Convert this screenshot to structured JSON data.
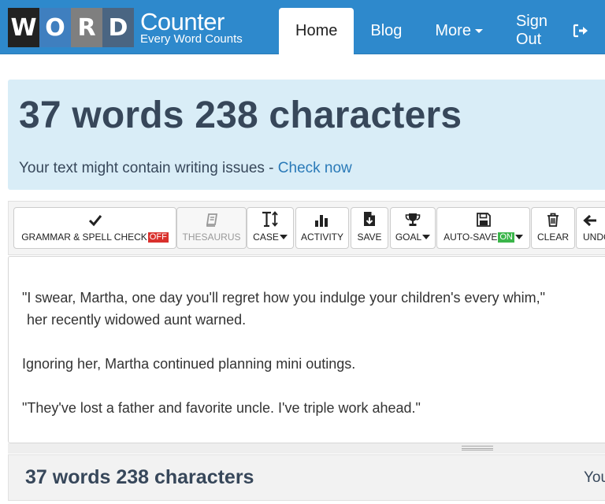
{
  "brand": {
    "letters": [
      "W",
      "O",
      "R",
      "D"
    ],
    "title": "Counter",
    "tagline": "Every Word Counts",
    "colors": {
      "navbar": "#2e89cc",
      "word_boxes": [
        "#222222",
        "#3f7fbf",
        "#7f7f7f",
        "#4a6582"
      ]
    }
  },
  "nav": {
    "home": "Home",
    "blog": "Blog",
    "more": "More",
    "signout": "Sign Out"
  },
  "stats": {
    "headline": "37 words 238 characters",
    "issues_text": "Your text might contain writing issues - ",
    "issues_link": "Check now"
  },
  "toolbar": {
    "grammar": {
      "label": "GRAMMAR & SPELL CHECK",
      "badge": "OFF",
      "icon": "checkmark-icon"
    },
    "thesaurus": {
      "label": "THESAURUS",
      "icon": "book-icon"
    },
    "case": {
      "label": "CASE",
      "icon": "text-case-icon"
    },
    "activity": {
      "label": "ACTIVITY",
      "icon": "bar-chart-icon"
    },
    "save": {
      "label": "SAVE",
      "icon": "download-file-icon"
    },
    "goal": {
      "label": "GOAL",
      "icon": "trophy-icon"
    },
    "autosave": {
      "label": "AUTO-SAVE",
      "badge": "ON",
      "icon": "floppy-disk-icon"
    },
    "clear": {
      "label": "CLEAR",
      "icon": "trash-icon"
    },
    "undo": {
      "label": "UNDO",
      "icon": "arrow-left-icon"
    }
  },
  "editor": {
    "paragraphs": [
      "\"I swear, Martha, one day you'll regret how you indulge your children's every whim,\"",
      "her recently widowed aunt warned.",
      "Ignoring her, Martha continued planning mini outings.",
      "\"They've lost a father and favorite uncle. I've triple work ahead.\""
    ]
  },
  "footer": {
    "headline": "37 words 238 characters",
    "trailing": "You"
  }
}
